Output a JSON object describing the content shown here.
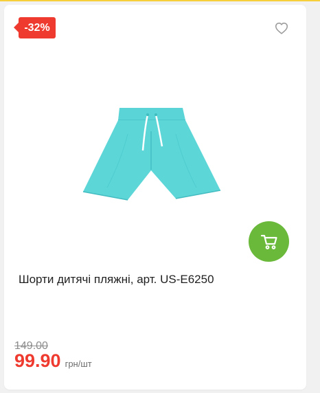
{
  "product": {
    "discount_badge": "-32%",
    "title": "Шорти дитячі пляжні, арт. US-E6250",
    "old_price": "149.00",
    "new_price": "99.90",
    "unit": "грн/шт",
    "image_alt": "shorts"
  },
  "icons": {
    "wishlist": "heart-outline-icon",
    "cart": "cart-icon"
  },
  "colors": {
    "accent_red": "#ef3b2f",
    "cart_green": "#6ab93a",
    "product_turquoise": "#53d3d6",
    "top_accent": "#f7cf3b"
  }
}
